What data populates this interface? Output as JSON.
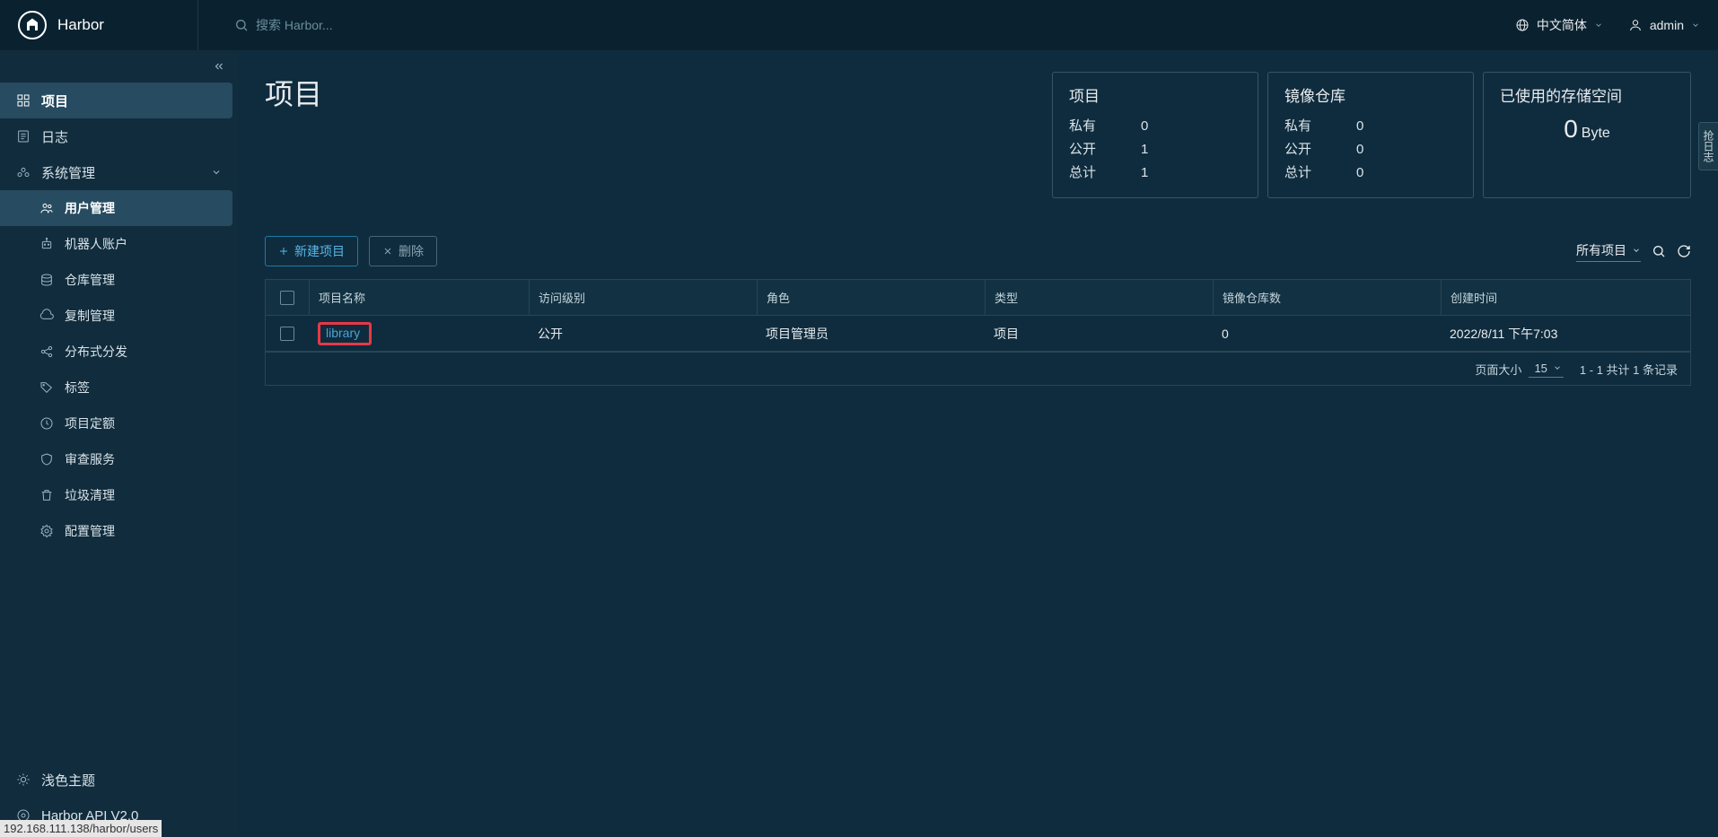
{
  "brand": "Harbor",
  "search_placeholder": "搜索 Harbor...",
  "header": {
    "language": "中文简体",
    "user": "admin"
  },
  "sidebar": {
    "projects": "项目",
    "logs": "日志",
    "admin": "系统管理",
    "users": "用户管理",
    "robots": "机器人账户",
    "repos": "仓库管理",
    "replication": "复制管理",
    "distribution": "分布式分发",
    "tags": "标签",
    "quotas": "项目定额",
    "audit": "审查服务",
    "gc": "垃圾清理",
    "config": "配置管理",
    "theme": "浅色主题",
    "api": "Harbor API V2.0"
  },
  "page_title": "项目",
  "cards": {
    "projects_title": "项目",
    "repos_title": "镜像仓库",
    "storage_title": "已使用的存储空间",
    "private": "私有",
    "public": "公开",
    "total": "总计",
    "projects": {
      "private": "0",
      "public": "1",
      "total": "1"
    },
    "repos": {
      "private": "0",
      "public": "0",
      "total": "0"
    },
    "storage_value": "0",
    "storage_unit": "Byte"
  },
  "toolbar": {
    "new": "新建项目",
    "delete": "删除",
    "filter": "所有项目"
  },
  "columns": {
    "name": "项目名称",
    "access": "访问级别",
    "role": "角色",
    "type": "类型",
    "repos": "镜像仓库数",
    "time": "创建时间"
  },
  "rows": [
    {
      "name": "library",
      "access": "公开",
      "role": "项目管理员",
      "type": "项目",
      "repos": "0",
      "time": "2022/8/11 下午7:03"
    }
  ],
  "pagination": {
    "page_size_label": "页面大小",
    "page_size": "15",
    "summary": "1 - 1 共计 1 条记录"
  },
  "status_url": "192.168.111.138/harbor/users",
  "side_tab": "抢日志"
}
